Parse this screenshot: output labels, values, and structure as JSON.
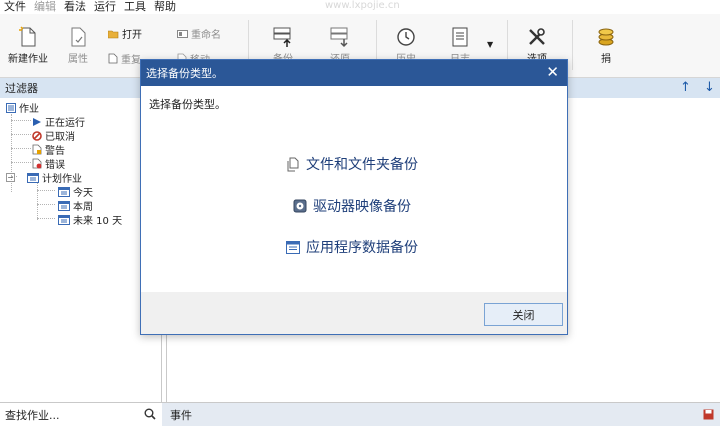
{
  "menu": {
    "items": [
      {
        "label": "文件",
        "enabled": true
      },
      {
        "label": "编辑",
        "enabled": false
      },
      {
        "label": "看法",
        "enabled": true
      },
      {
        "label": "运行",
        "enabled": true
      },
      {
        "label": "工具",
        "enabled": true
      },
      {
        "label": "帮助",
        "enabled": true
      }
    ],
    "watermark": "www.lxpojie.cn"
  },
  "ribbon": {
    "new_job": "新建作业",
    "properties": "属性",
    "open": "打开",
    "reset": "重复",
    "rename": "重命名",
    "move": "移动",
    "backup": "备份",
    "restore": "还原",
    "history": "历史",
    "log": "日志",
    "options": "选项",
    "donate": "捐"
  },
  "filter": {
    "header": "过滤器",
    "tree": {
      "root": "作业",
      "running": "正在运行",
      "cancelled": "已取消",
      "warning": "警告",
      "error": "错误",
      "scheduled": "计划作业",
      "today": "今天",
      "this_week": "本周",
      "next_10_days": "未来 10 天"
    },
    "search_placeholder": "查找作业..."
  },
  "right": {
    "up_arrow": "↑",
    "down_arrow": "↓"
  },
  "events": {
    "label": "事件"
  },
  "dialog": {
    "title": "选择备份类型。",
    "prompt": "选择备份类型。",
    "options": [
      {
        "label": "文件和文件夹备份",
        "icon": "files-icon"
      },
      {
        "label": "驱动器映像备份",
        "icon": "disk-icon"
      },
      {
        "label": "应用程序数据备份",
        "icon": "app-window-icon"
      }
    ],
    "close_button": "关闭",
    "close_x": "✕"
  },
  "colors": {
    "title_bar": "#2b5797",
    "pane_header": "#d7e4f2",
    "option_text": "#1f3f7a"
  }
}
